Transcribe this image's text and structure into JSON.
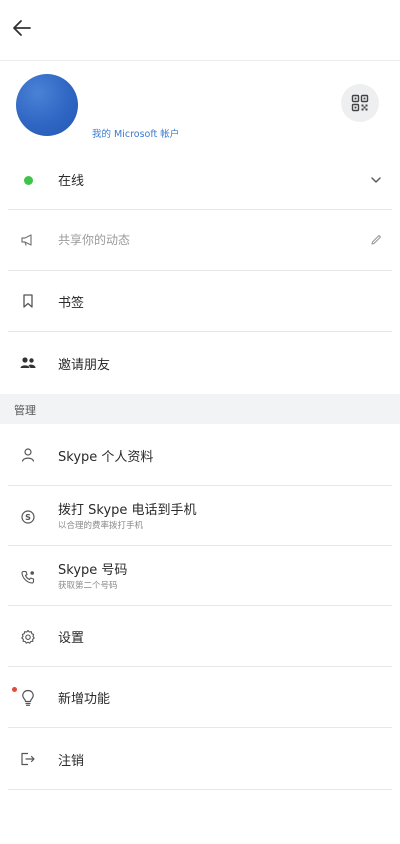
{
  "profile": {
    "account_link": "我的 Microsoft 帐户"
  },
  "menu": {
    "status": "在线",
    "share_placeholder": "共享你的动态",
    "bookmarks": "书签",
    "invite_friends": "邀请朋友",
    "section_manage": "管理",
    "skype_profile": "Skype 个人资料",
    "skype_to_phone": "拨打 Skype 电话到手机",
    "skype_to_phone_sub": "以合理的费率拨打手机",
    "skype_number": "Skype 号码",
    "skype_number_sub": "获取第二个号码",
    "settings": "设置",
    "whats_new": "新增功能",
    "sign_out": "注销"
  },
  "colors": {
    "status_online": "#3ec44a",
    "link": "#3a7ad1",
    "notification": "#e24a3a",
    "avatar": "#2f66c3"
  },
  "icons": [
    "back-arrow-icon",
    "qr-code-icon",
    "status-online-icon",
    "chevron-down-icon",
    "megaphone-icon",
    "pencil-icon",
    "bookmark-icon",
    "people-icon",
    "person-icon",
    "skype-icon",
    "phone-icon",
    "gear-icon",
    "lightbulb-icon",
    "sign-out-icon"
  ]
}
